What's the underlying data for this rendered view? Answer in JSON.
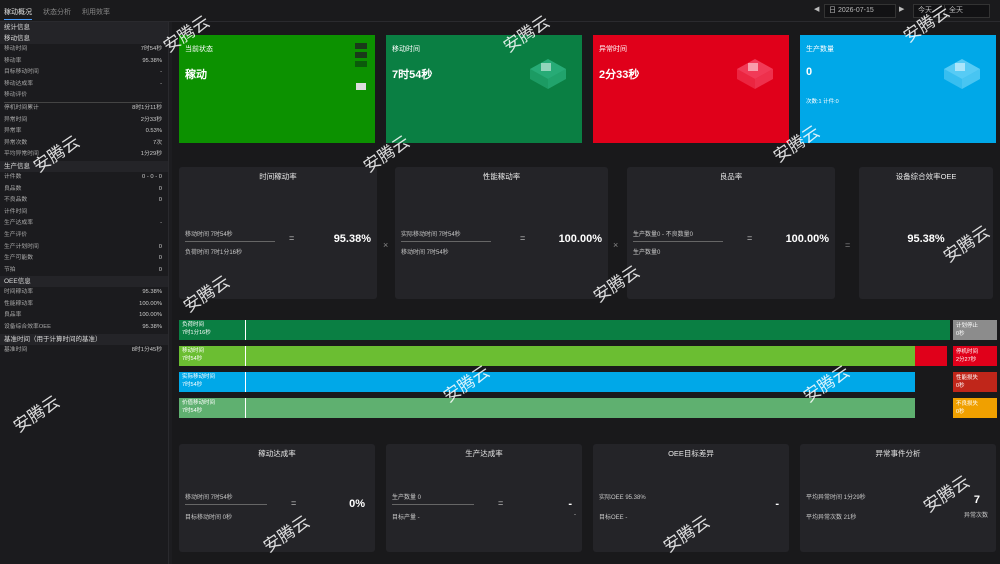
{
  "tabs": [
    "稼动概况",
    "状态分析",
    "利用效率"
  ],
  "date": {
    "prefix": "日",
    "value": "2026-07-15",
    "prev": "◀",
    "next": "▶",
    "range": "今天",
    "mode": "全天"
  },
  "sidebar": {
    "sections": [
      {
        "title": "统计信息",
        "rows": []
      },
      {
        "title": "移动信息",
        "rows": [
          {
            "label": "移动时间",
            "value": "7时54秒"
          },
          {
            "label": "移动率",
            "value": "95.38%"
          },
          {
            "label": "目标移动时间",
            "value": "-"
          },
          {
            "label": "移动达成率",
            "value": "-"
          },
          {
            "label": "移动评价",
            "value": ""
          },
          {
            "label": "停机时间累计",
            "value": "8时1分11秒"
          },
          {
            "label": "异常时间",
            "value": "2分33秒"
          },
          {
            "label": "异常率",
            "value": "0.53%"
          },
          {
            "label": "异常次数",
            "value": "7次"
          },
          {
            "label": "平均异常时间",
            "value": "1分29秒"
          }
        ]
      },
      {
        "title": "生产信息",
        "rows": [
          {
            "label": "计件数",
            "value": "0 - 0 - 0"
          },
          {
            "label": "良品数",
            "value": "0"
          },
          {
            "label": "不良品数",
            "value": "0"
          },
          {
            "label": "计件时间",
            "value": ""
          },
          {
            "label": "生产达成率",
            "value": "-"
          },
          {
            "label": "生产评价",
            "value": ""
          },
          {
            "label": "生产计划时间",
            "value": "0"
          },
          {
            "label": "生产可能数",
            "value": "0"
          },
          {
            "label": "节拍",
            "value": "0"
          }
        ]
      },
      {
        "title": "OEE信息",
        "rows": [
          {
            "label": "时间稼动率",
            "value": "95.38%"
          },
          {
            "label": "性能稼动率",
            "value": "100.00%"
          },
          {
            "label": "良品率",
            "value": "100.00%"
          },
          {
            "label": "设备综合效率OEE",
            "value": "95.38%"
          }
        ]
      },
      {
        "title": "基准时间（用于计算时间的基准）",
        "rows": [
          {
            "label": "基准时间",
            "value": "8时1分45秒"
          }
        ]
      }
    ]
  },
  "status_cards": [
    {
      "title": "当前状态",
      "value": "稼动",
      "sub": "",
      "color": "#0c9100",
      "icon": "status-light-icon"
    },
    {
      "title": "移动时间",
      "value": "7时54秒",
      "sub": "",
      "color": "#0a7f43",
      "icon": "machine-icon"
    },
    {
      "title": "异常时间",
      "value": "2分33秒",
      "sub": "",
      "color": "#e0001a",
      "icon": "machine-icon"
    },
    {
      "title": "生产数量",
      "value": "0",
      "sub": "次数:1  计件:0",
      "color": "#00a8e8",
      "icon": "machine-icon"
    }
  ],
  "oee_cards": [
    {
      "title": "时间稼动率",
      "num": "移动时间 7时54秒",
      "den": "负荷时间 7时1分16秒",
      "op": "=",
      "pct": "95.38%"
    },
    {
      "title": "性能稼动率",
      "num": "实际移动时间 7时54秒",
      "den": "移动时间 7时54秒",
      "op": "=",
      "pct": "100.00%"
    },
    {
      "title": "良品率",
      "num": "生产数量0 - 不良数量0",
      "den": "生产数量0",
      "op": "=",
      "pct": "100.00%"
    },
    {
      "title": "设备综合效率OEE",
      "pct": "95.38%"
    }
  ],
  "operators": [
    "×",
    "×",
    "="
  ],
  "bars": [
    {
      "l1": "负荷时间",
      "l2": "7时1分16秒",
      "color": "#0a7f43",
      "fill": 1.0,
      "right": "计划停止\n0秒",
      "rcolor": "#8c8c8c"
    },
    {
      "l1": "移动时间",
      "l2": "7时54秒",
      "color": "#6bbe32",
      "fill": 0.955,
      "red": true,
      "right": "停机时间\n2分27秒",
      "rcolor": "#e0001a"
    },
    {
      "l1": "实际移动时间",
      "l2": "7时54秒",
      "color": "#00a8e8",
      "fill": 0.955,
      "right": "性能损失\n0秒",
      "rcolor": "#c0261a"
    },
    {
      "l1": "价值移动时间",
      "l2": "7时54秒",
      "color": "#5fb070",
      "fill": 0.955,
      "right": "不良损失\n0秒",
      "rcolor": "#f0a000"
    }
  ],
  "bottom_cards": [
    {
      "title": "稼动达成率",
      "num": "移动时间 7时54秒",
      "den": "目标移动时间 0秒",
      "op": "=",
      "pct": "0%"
    },
    {
      "title": "生产达成率",
      "num": "生产数量 0",
      "den": "目标产量 -",
      "op": "=",
      "pct": "-",
      "right": "-"
    },
    {
      "title": "OEE目标差异",
      "num": "实际OEE 95.38%",
      "den": "目标OEE -",
      "pct": "-"
    },
    {
      "title": "异常事件分析",
      "num": "平均异常时间 1分29秒",
      "den": "平均异常次数 21秒",
      "pct": "7",
      "pct_label": "异常次数"
    }
  ],
  "watermark": "安腾云"
}
